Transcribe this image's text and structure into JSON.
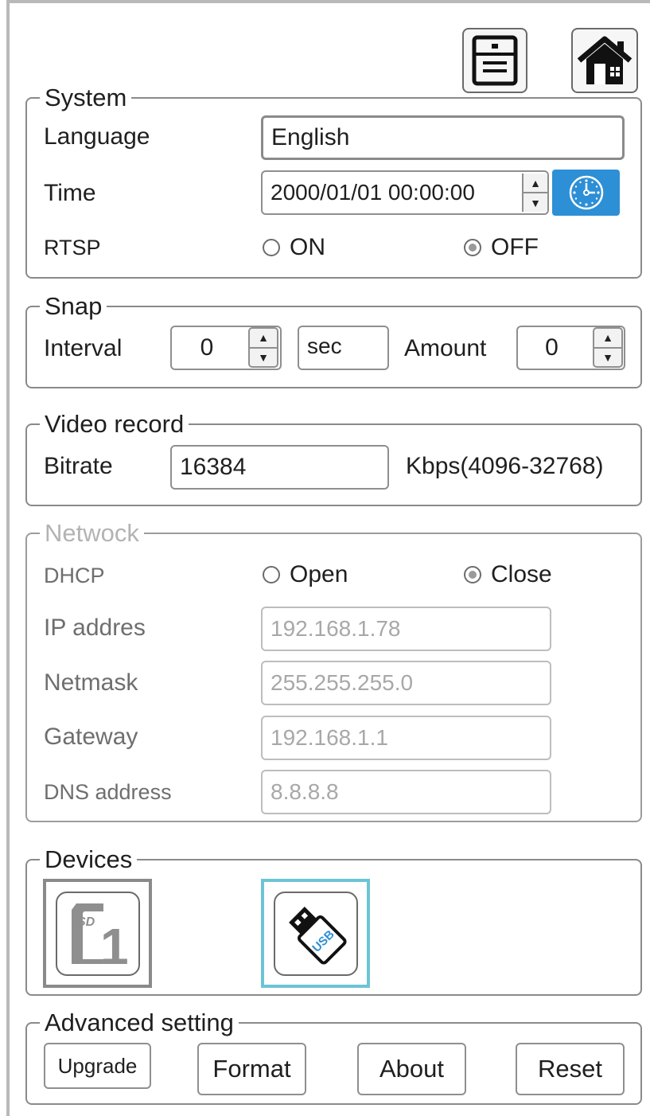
{
  "toolbar": {
    "save_icon": "save-icon",
    "home_icon": "home-icon"
  },
  "system": {
    "legend": "System",
    "language_label": "Language",
    "language_value": "English",
    "time_label": "Time",
    "time_value": "2000/01/01  00:00:00",
    "rtsp_label": "RTSP",
    "rtsp_on": "ON",
    "rtsp_off": "OFF",
    "rtsp_selected": "OFF",
    "clock_icon": "clock-icon",
    "accent_color": "#2d8fd5"
  },
  "snap": {
    "legend": "Snap",
    "interval_label": "Interval",
    "interval_value": "0",
    "unit": "sec",
    "amount_label": "Amount",
    "amount_value": "0"
  },
  "video": {
    "legend": "Video record",
    "bitrate_label": "Bitrate",
    "bitrate_value": "16384",
    "bitrate_unit": "Kbps(4096-32768)"
  },
  "network": {
    "legend": "Netwock",
    "dhcp_label": "DHCP",
    "dhcp_open": "Open",
    "dhcp_close": "Close",
    "dhcp_selected": "Close",
    "ip_label": "IP addres",
    "ip_value": "192.168.1.78",
    "netmask_label": "Netmask",
    "netmask_value": "255.255.255.0",
    "gateway_label": "Gateway",
    "gateway_value": "192.168.1.1",
    "dns_label": "DNS address",
    "dns_value": "8.8.8.8"
  },
  "devices": {
    "legend": "Devices",
    "sd_icon": "sd-card-icon",
    "sd_badge": "SD",
    "sd_number": "1",
    "usb_icon": "usb-drive-icon",
    "usb_text": "USB",
    "selected": "USB"
  },
  "advanced": {
    "legend": "Advanced setting",
    "upgrade": "Upgrade",
    "format": "Format",
    "about": "About",
    "reset": "Reset"
  }
}
